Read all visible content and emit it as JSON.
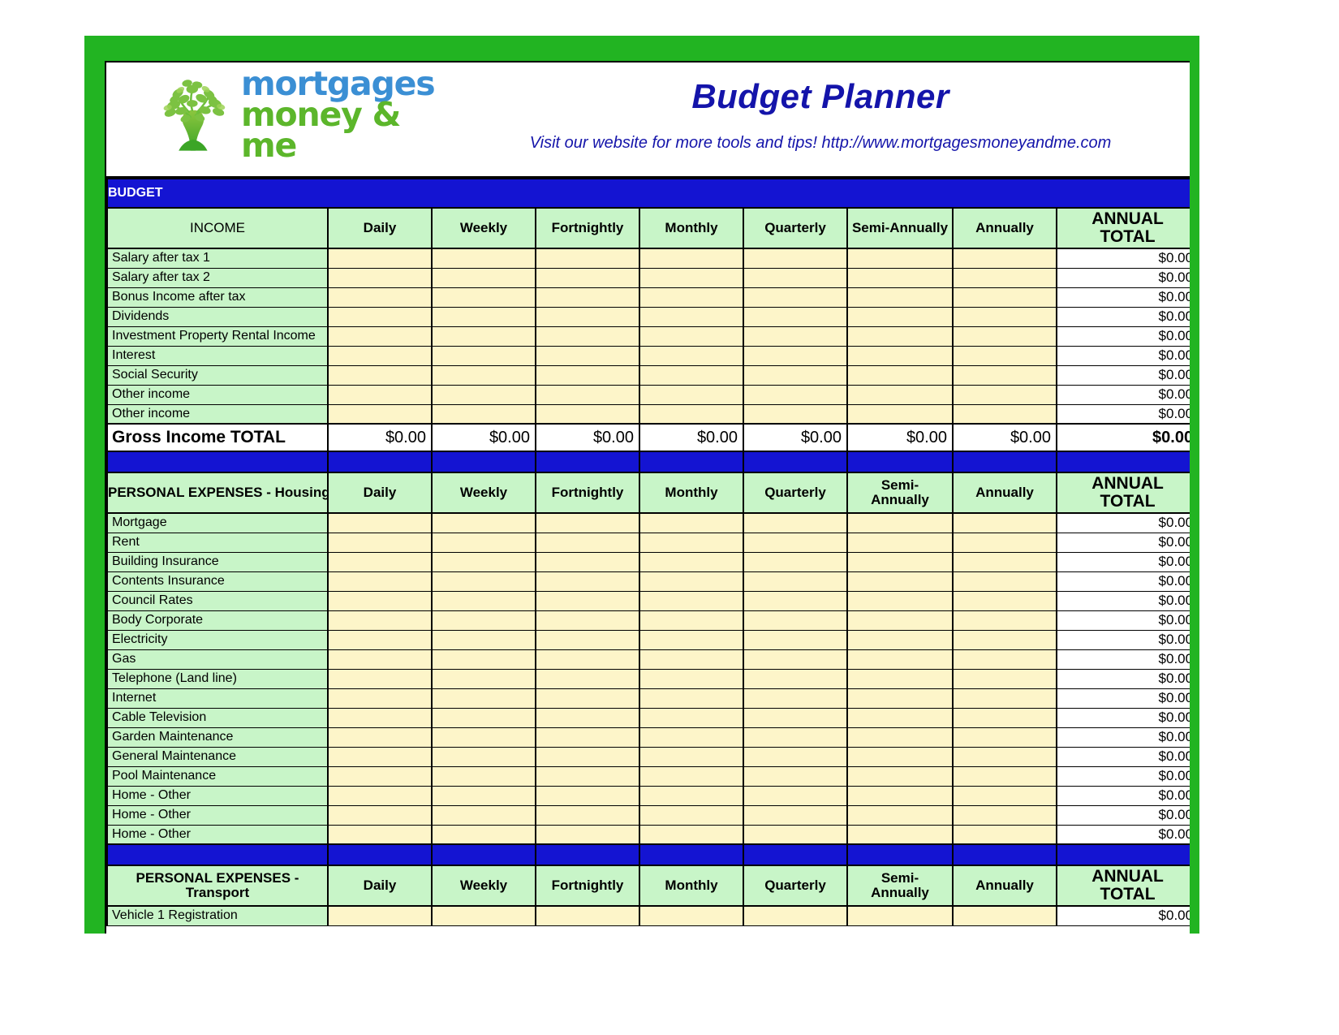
{
  "brand": {
    "logo_line1": "mortgages",
    "logo_line2": "money & me",
    "logo_icon": "tree-logo-icon"
  },
  "header": {
    "title": "Budget Planner",
    "subtitle": "Visit our website for more tools and tips!  http://www.mortgagesmoneyandme.com"
  },
  "section_bar": {
    "budget_label": "BUDGET"
  },
  "colors": {
    "frame_green": "#22b422",
    "bar_blue": "#1414d2",
    "title_blue": "#1414aa",
    "header_green": "#c8f5c8",
    "entry_cream": "#fdf5c9",
    "logo_blue": "#3b8fd4",
    "logo_green": "#5cb62b"
  },
  "columns": {
    "periods": [
      "Daily",
      "Weekly",
      "Fortnightly",
      "Monthly",
      "Quarterly",
      "Semi-Annually",
      "Annually"
    ],
    "periods_wrapped": [
      "Daily",
      "Weekly",
      "Fortnightly",
      "Monthly",
      "Quarterly",
      "Semi-\nAnnually",
      "Annually"
    ],
    "total_line1": "ANNUAL",
    "total_line2": "TOTAL"
  },
  "sections": [
    {
      "id": "income",
      "header_label": "INCOME",
      "header_bold": false,
      "semi_wrapped": false,
      "rows": [
        {
          "label": "Salary after tax 1",
          "total": "$0.00"
        },
        {
          "label": "Salary after tax 2",
          "total": "$0.00"
        },
        {
          "label": "Bonus Income after tax",
          "total": "$0.00"
        },
        {
          "label": "Dividends",
          "total": "$0.00"
        },
        {
          "label": "Investment Property Rental Income",
          "total": "$0.00"
        },
        {
          "label": "Interest",
          "total": "$0.00"
        },
        {
          "label": "Social Security",
          "total": "$0.00"
        },
        {
          "label": "Other income",
          "total": "$0.00"
        },
        {
          "label": "Other income",
          "total": "$0.00"
        }
      ],
      "total_row": {
        "label": "Gross Income TOTAL",
        "values": [
          "$0.00",
          "$0.00",
          "$0.00",
          "$0.00",
          "$0.00",
          "$0.00",
          "$0.00"
        ],
        "annual_total": "$0.00"
      }
    },
    {
      "id": "housing",
      "header_label": "PERSONAL EXPENSES - Housing",
      "header_bold": true,
      "semi_wrapped": true,
      "rows": [
        {
          "label": "Mortgage",
          "total": "$0.00"
        },
        {
          "label": "Rent",
          "total": "$0.00"
        },
        {
          "label": "Building Insurance",
          "total": "$0.00"
        },
        {
          "label": "Contents Insurance",
          "total": "$0.00"
        },
        {
          "label": "Council Rates",
          "total": "$0.00"
        },
        {
          "label": "Body Corporate",
          "total": "$0.00"
        },
        {
          "label": "Electricity",
          "total": "$0.00"
        },
        {
          "label": "Gas",
          "total": "$0.00"
        },
        {
          "label": "Telephone (Land line)",
          "total": "$0.00"
        },
        {
          "label": "Internet",
          "total": "$0.00"
        },
        {
          "label": "Cable Television",
          "total": "$0.00"
        },
        {
          "label": "Garden Maintenance",
          "total": "$0.00"
        },
        {
          "label": "General Maintenance",
          "total": "$0.00"
        },
        {
          "label": "Pool Maintenance",
          "total": "$0.00"
        },
        {
          "label": "Home - Other",
          "total": "$0.00"
        },
        {
          "label": "Home - Other",
          "total": "$0.00"
        },
        {
          "label": "Home - Other",
          "total": "$0.00"
        }
      ],
      "total_row": null
    },
    {
      "id": "transport",
      "header_label": "PERSONAL EXPENSES -\nTransport",
      "header_bold": true,
      "semi_wrapped": true,
      "rows": [
        {
          "label": "Vehicle 1 Registration",
          "total": "$0.00"
        }
      ],
      "total_row": null
    }
  ]
}
